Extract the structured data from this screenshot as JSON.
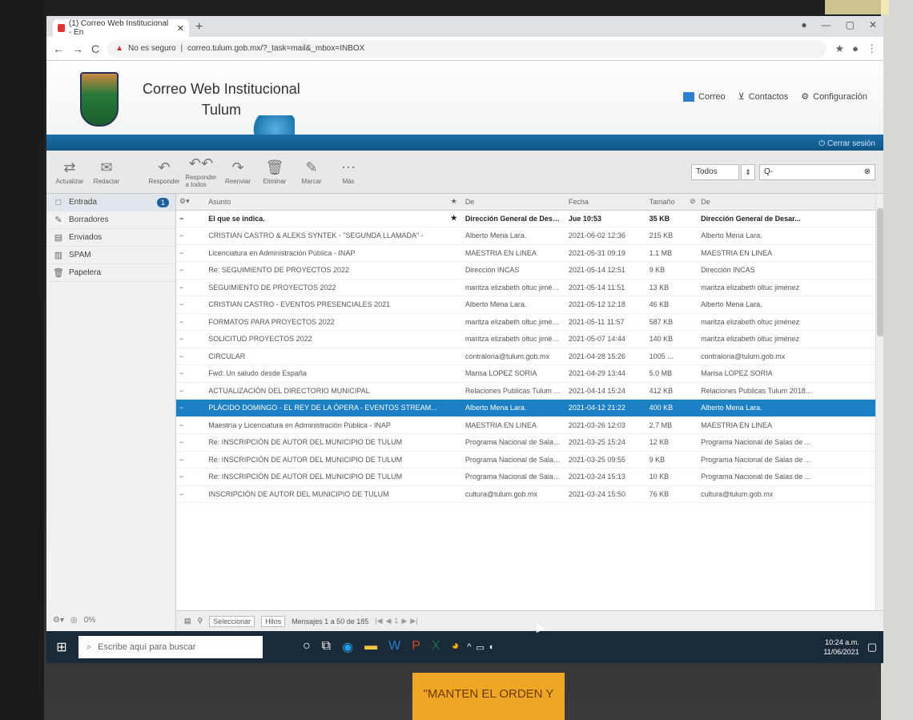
{
  "browser": {
    "tab_title": "(1) Correo Web Institucional - En",
    "tab_close": "✕",
    "new_tab": "+",
    "security_label": "No es seguro",
    "url": "correo.tulum.gob.mx/?_task=mail&_mbox=INBOX",
    "window_controls": [
      "●",
      "—",
      "▢",
      "✕"
    ]
  },
  "app": {
    "title_line1": "Correo Web Institucional",
    "title_line2": "Tulum",
    "nav": [
      {
        "label": "Correo",
        "icon": "mail-icon"
      },
      {
        "label": "Contactos",
        "icon": "contacts-icon"
      },
      {
        "label": "Configuración",
        "icon": "gear-icon"
      }
    ],
    "logout": "Cerrar sesión"
  },
  "toolbar": {
    "buttons": [
      {
        "label": "Actualizar",
        "icon": "⇄"
      },
      {
        "label": "Redactar",
        "icon": "✉"
      },
      {
        "label": "Responder",
        "icon": "↶"
      },
      {
        "label": "Responder a todos",
        "icon": "↶↶"
      },
      {
        "label": "Reenviar",
        "icon": "↷"
      },
      {
        "label": "Eliminar",
        "icon": "🗑"
      },
      {
        "label": "Marcar",
        "icon": "✎"
      },
      {
        "label": "Más",
        "icon": "⋯"
      }
    ],
    "filter_value": "Todos",
    "search_placeholder": "Q-"
  },
  "folders": [
    {
      "label": "Entrada",
      "icon": "□",
      "badge": "1",
      "active": true
    },
    {
      "label": "Borradores",
      "icon": "✎",
      "badge": ""
    },
    {
      "label": "Enviados",
      "icon": "▤",
      "badge": ""
    },
    {
      "label": "SPAM",
      "icon": "▥",
      "badge": ""
    },
    {
      "label": "Papelera",
      "icon": "🗑",
      "badge": ""
    }
  ],
  "quota": "0%",
  "table": {
    "headers": {
      "subject": "Asunto",
      "from": "De",
      "date": "Fecha",
      "size": "Tamaño",
      "to": "De"
    },
    "rows": [
      {
        "subject": "El que se indica.",
        "from": "Dirección General de Desarr...",
        "date": "Jue 10:53",
        "size": "35 KB",
        "to": "Dirección General de Desar...",
        "unread": true,
        "selected": false
      },
      {
        "subject": "CRISTIAN CASTRO & ALEKS SYNTEK - \"SEGUNDA LLAMADA\" -",
        "from": "Alberto Mena Lara.",
        "date": "2021-06-02 12:36",
        "size": "215 KB",
        "to": "Alberto Mena Lara.",
        "unread": false,
        "selected": false
      },
      {
        "subject": "Licenciatura en Administración Pública - INAP",
        "from": "MAESTRIA EN LINEA",
        "date": "2021-05-31 09:19",
        "size": "1.1 MB",
        "to": "MAESTRIA EN LINEA",
        "unread": false,
        "selected": false
      },
      {
        "subject": "Re: SEGUIMIENTO DE PROYECTOS 2022",
        "from": "Dirección INCAS",
        "date": "2021-05-14 12:51",
        "size": "9 KB",
        "to": "Dirección INCAS",
        "unread": false,
        "selected": false
      },
      {
        "subject": "SEGUIMIENTO DE PROYECTOS 2022",
        "from": "maritza elizabeth oltuc jiménez",
        "date": "2021-05-14 11:51",
        "size": "13 KB",
        "to": "maritza elizabeth oltuc jiménez",
        "unread": false,
        "selected": false
      },
      {
        "subject": "CRISTIAN CASTRO - EVENTOS PRESENCIALES 2021",
        "from": "Alberto Mena Lara.",
        "date": "2021-05-12 12:18",
        "size": "46 KB",
        "to": "Alberto Mena Lara.",
        "unread": false,
        "selected": false
      },
      {
        "subject": "FORMATOS PARA PROYECTOS 2022",
        "from": "maritza elizabeth oltuc jiménez",
        "date": "2021-05-11 11:57",
        "size": "587 KB",
        "to": "maritza elizabeth oltuc jiménez",
        "unread": false,
        "selected": false
      },
      {
        "subject": "SOLICITUD PROYECTOS 2022",
        "from": "maritza elizabeth oltuc jiménez",
        "date": "2021-05-07 14:44",
        "size": "140 KB",
        "to": "maritza elizabeth oltuc jiménez",
        "unread": false,
        "selected": false
      },
      {
        "subject": "CIRCULAR",
        "from": "contraloria@tulum.gob.mx",
        "date": "2021-04-28 15:26",
        "size": "1005 ...",
        "to": "contraloria@tulum.gob.mx",
        "unread": false,
        "selected": false
      },
      {
        "subject": "Fwd: Un saludo desde España",
        "from": "Marisa LOPEZ SORIA",
        "date": "2021-04-29 13:44",
        "size": "5.0 MB",
        "to": "Marisa LOPEZ SORIA",
        "unread": false,
        "selected": false
      },
      {
        "subject": "ACTUALIZACIÓN DEL DIRECTORIO MUNICIPAL",
        "from": "Relaciones Publicas Tulum 2018...",
        "date": "2021-04-14 15:24",
        "size": "412 KB",
        "to": "Relaciones Publicas Tulum 2018...",
        "unread": false,
        "selected": false
      },
      {
        "subject": "PLÁCIDO DOMINGO - EL REY DE LA ÓPERA - EVENTOS STREAM...",
        "from": "Alberto Mena Lara.",
        "date": "2021-04-12 21:22",
        "size": "400 KB",
        "to": "Alberto Mena Lara.",
        "unread": false,
        "selected": true
      },
      {
        "subject": "Maestría y Licenciatura en Administración Pública - INAP",
        "from": "MAESTRIA EN LINEA",
        "date": "2021-03-26 12:03",
        "size": "2.7 MB",
        "to": "MAESTRIA EN LINEA",
        "unread": false,
        "selected": false
      },
      {
        "subject": "Re: INSCRIPCIÓN DE AUTOR DEL MUNICIPIO DE TULUM",
        "from": "Programa Nacional de Salas de ...",
        "date": "2021-03-25 15:24",
        "size": "12 KB",
        "to": "Programa Nacional de Salas de ...",
        "unread": false,
        "selected": false
      },
      {
        "subject": "Re: INSCRIPCIÓN DE AUTOR DEL MUNICIPIO DE TULUM",
        "from": "Programa Nacional de Salas de ...",
        "date": "2021-03-25 09:55",
        "size": "9 KB",
        "to": "Programa Nacional de Salas de ...",
        "unread": false,
        "selected": false
      },
      {
        "subject": "Re: INSCRIPCIÓN DE AUTOR DEL MUNICIPIO DE TULUM",
        "from": "Programa Nacional de Salas de ...",
        "date": "2021-03-24 15:13",
        "size": "10 KB",
        "to": "Programa Nacional de Salas de ...",
        "unread": false,
        "selected": false
      },
      {
        "subject": "INSCRIPCIÓN DE AUTOR DEL MUNICIPIO DE TULUM",
        "from": "cultura@tulum.gob.mx",
        "date": "2021-03-24 15:50",
        "size": "76 KB",
        "to": "cultura@tulum.gob.mx",
        "unread": false,
        "selected": false
      }
    ]
  },
  "pager": {
    "select_label": "Seleccionar",
    "threads_label": "Hilos",
    "count": "Mensajes 1 a 50 de 185"
  },
  "taskbar": {
    "search_placeholder": "Escribe aquí para buscar",
    "time": "10:24 a.m.",
    "date": "11/06/2021"
  },
  "sign": "\"MANTEN EL ORDEN Y"
}
